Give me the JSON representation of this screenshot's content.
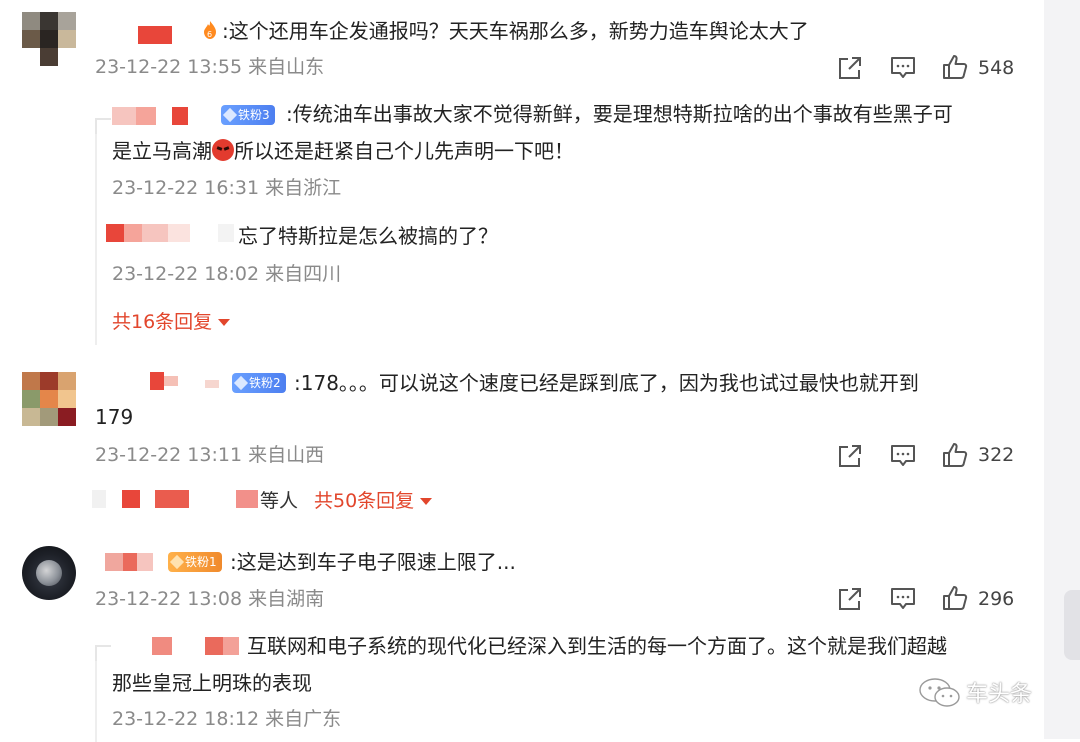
{
  "comments": [
    {
      "text": ":这个还用车企发通报吗？天天车祸那么多，新势力造车舆论太大了",
      "meta": "23-12-22 13:55 来自山东",
      "likes": "548",
      "replies": [
        {
          "badge": "铁粉3",
          "text_line1": ":传统油车出事故大家不觉得新鲜，要是理想特斯拉啥的出个事故有些黑子可",
          "text_line2a": "是立马高潮",
          "text_line2b": "所以还是赶紧自己个儿先声明一下吧！",
          "meta": "23-12-22 16:31 来自浙江"
        },
        {
          "text": "忘了特斯拉是怎么被搞的了？",
          "meta": "23-12-22 18:02 来自四川"
        }
      ],
      "more": "共16条回复"
    },
    {
      "badge": "铁粉2",
      "text_line1": ":178。。。可以说这个速度已经是踩到底了，因为我也试过最快也就开到",
      "text_line2": "179",
      "meta": "23-12-22 13:11 来自山西",
      "likes": "322",
      "others": "等人",
      "more": "共50条回复"
    },
    {
      "badge": "铁粉1",
      "text": ":这是达到车子电子限速上限了...",
      "meta": "23-12-22 13:08 来自湖南",
      "likes": "296",
      "replies": [
        {
          "text_line1": "互联网和电子系统的现代化已经深入到生活的每一个方面了。这个就是我们超越",
          "text_line2": "那些皇冠上明珠的表现",
          "meta": "23-12-22 18:12 来自广东"
        }
      ]
    }
  ],
  "watermark": "车头条",
  "icons": [
    "share-icon",
    "comment-icon",
    "like-icon",
    "wechat-icon"
  ],
  "colors": {
    "link": "#e2462c",
    "meta": "#8a8a8a",
    "badge": "#4d7ff0",
    "mosaic_red": "#e8463a"
  }
}
